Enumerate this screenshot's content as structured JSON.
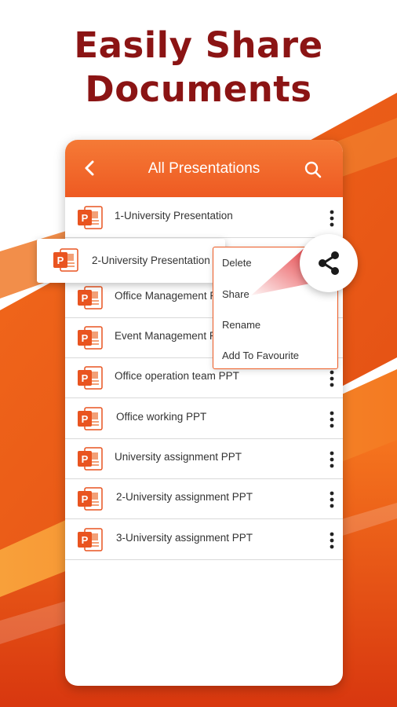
{
  "promo": {
    "headline_line1": "Easily Share",
    "headline_line2": "Documents"
  },
  "app_bar": {
    "title": "All Presentations"
  },
  "files": [
    {
      "name": "1-University Presentation"
    },
    {
      "name": "Office Management PPT"
    },
    {
      "name": "Event Management PPT"
    },
    {
      "name": "Office operation team PPT"
    },
    {
      "name": "Office working PPT"
    },
    {
      "name": "University assignment PPT"
    },
    {
      "name": "2-University assignment PPT"
    },
    {
      "name": "3-University assignment PPT"
    }
  ],
  "selected_file": {
    "name": "2-University Presentation"
  },
  "context_menu": {
    "items": [
      "Delete",
      "Share",
      "Rename",
      "Add To Favourite"
    ]
  },
  "icons": {
    "back": "chevron-left-icon",
    "search": "search-icon",
    "more": "more-vertical-icon",
    "file": "powerpoint-file-icon",
    "share": "share-icon"
  },
  "colors": {
    "accent": "#ee5a22",
    "headline": "#8b1414",
    "share_beam": "#e3262b"
  }
}
